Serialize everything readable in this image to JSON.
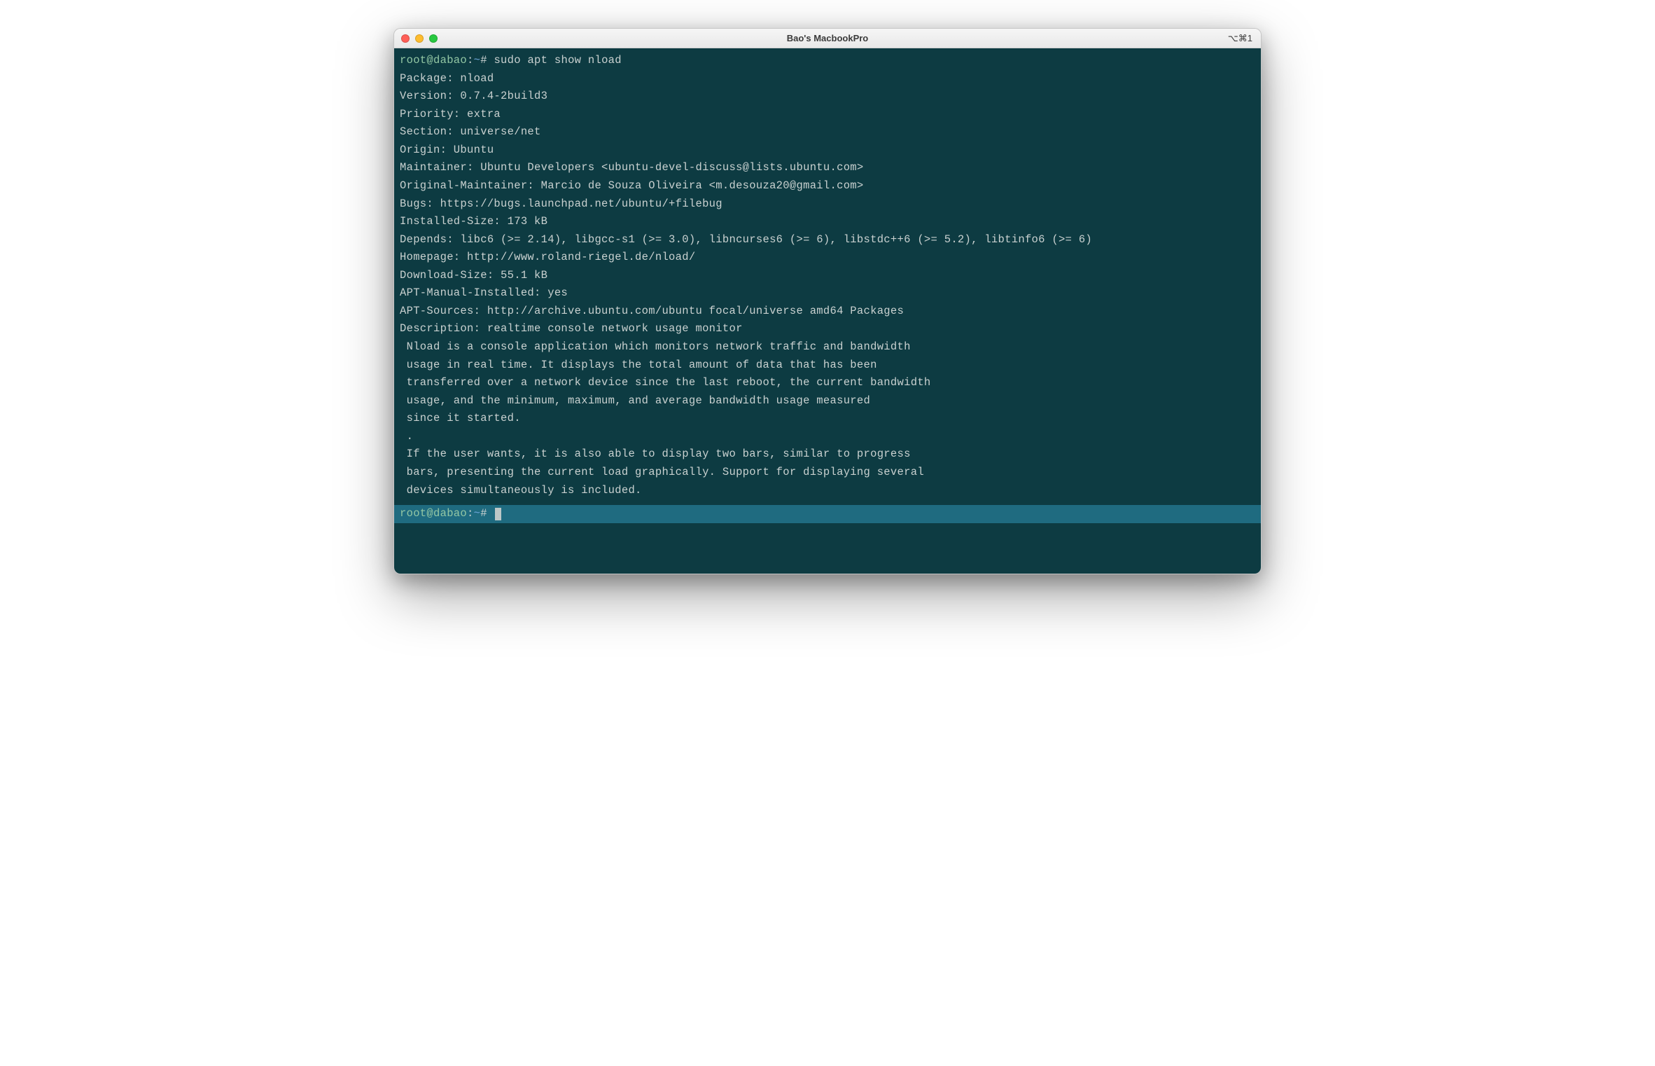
{
  "window": {
    "title": "Bao's MacbookPro",
    "shortcut": "⌥⌘1"
  },
  "prompt": {
    "userhost": "root@dabao",
    "sep": ":",
    "path": "~",
    "symbol": "#"
  },
  "command": "sudo apt show nload",
  "output_lines": [
    "Package: nload",
    "Version: 0.7.4-2build3",
    "Priority: extra",
    "Section: universe/net",
    "Origin: Ubuntu",
    "Maintainer: Ubuntu Developers <ubuntu-devel-discuss@lists.ubuntu.com>",
    "Original-Maintainer: Marcio de Souza Oliveira <m.desouza20@gmail.com>",
    "Bugs: https://bugs.launchpad.net/ubuntu/+filebug",
    "Installed-Size: 173 kB",
    "Depends: libc6 (>= 2.14), libgcc-s1 (>= 3.0), libncurses6 (>= 6), libstdc++6 (>= 5.2), libtinfo6 (>= 6)",
    "Homepage: http://www.roland-riegel.de/nload/",
    "Download-Size: 55.1 kB",
    "APT-Manual-Installed: yes",
    "APT-Sources: http://archive.ubuntu.com/ubuntu focal/universe amd64 Packages",
    "Description: realtime console network usage monitor",
    " Nload is a console application which monitors network traffic and bandwidth",
    " usage in real time. It displays the total amount of data that has been",
    " transferred over a network device since the last reboot, the current bandwidth",
    " usage, and the minimum, maximum, and average bandwidth usage measured",
    " since it started.",
    " .",
    " If the user wants, it is also able to display two bars, similar to progress",
    " bars, presenting the current load graphically. Support for displaying several",
    " devices simultaneously is included.",
    ""
  ]
}
